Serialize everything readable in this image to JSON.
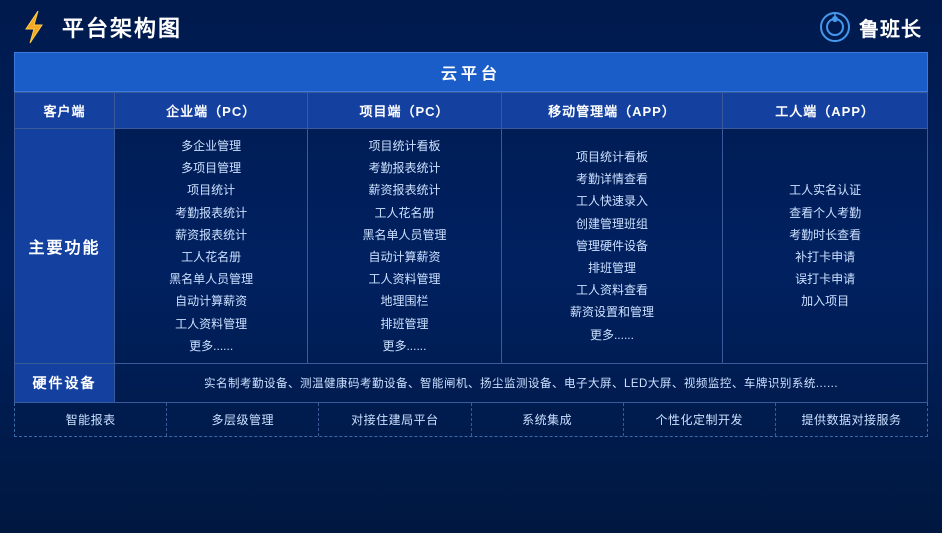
{
  "header": {
    "title": "平台架构图",
    "brand": "鲁班长"
  },
  "cloud_platform": "云平台",
  "columns": {
    "client": "客户端",
    "enterprise": "企业端（PC）",
    "project": "项目端（PC）",
    "mobile": "移动管理端（APP）",
    "worker": "工人端（APP）"
  },
  "main_function_label": "主要功能",
  "enterprise_features": [
    "多企业管理",
    "多项目管理",
    "项目统计",
    "考勤报表统计",
    "薪资报表统计",
    "工人花名册",
    "黑名单人员管理",
    "自动计算薪资",
    "工人资料管理",
    "更多......"
  ],
  "project_features": [
    "项目统计看板",
    "考勤报表统计",
    "薪资报表统计",
    "工人花名册",
    "黑名单人员管理",
    "自动计算薪资",
    "工人资料管理",
    "地理围栏",
    "排班管理",
    "更多......"
  ],
  "mobile_features": [
    "项目统计看板",
    "考勤详情查看",
    "工人快速录入",
    "创建管理班组",
    "管理硬件设备",
    "排班管理",
    "工人资料查看",
    "薪资设置和管理",
    "更多......"
  ],
  "worker_features": [
    "工人实名认证",
    "查看个人考勤",
    "考勤时长查看",
    "补打卡申请",
    "误打卡申请",
    "加入项目"
  ],
  "hardware": {
    "label": "硬件设备",
    "content": "实名制考勤设备、测温健康码考勤设备、智能闸机、扬尘监测设备、电子大屏、LED大屏、视频监控、车牌识别系统......"
  },
  "bottom_features": [
    "智能报表",
    "多层级管理",
    "对接住建局平台",
    "系统集成",
    "个性化定制开发",
    "提供数据对接服务"
  ]
}
